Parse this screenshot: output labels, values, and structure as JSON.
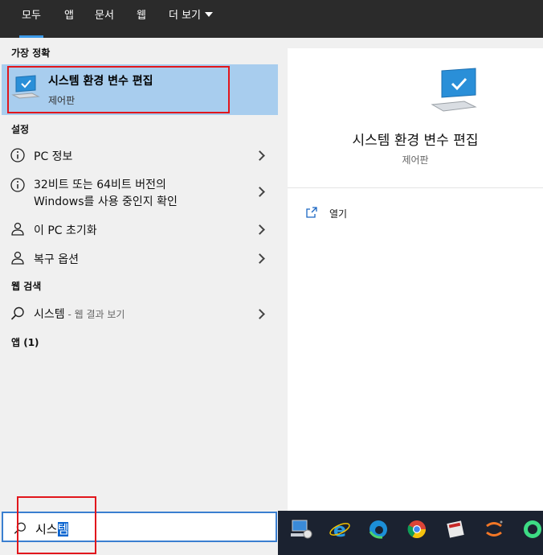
{
  "tabs": [
    {
      "label": "모두",
      "active": true
    },
    {
      "label": "앱"
    },
    {
      "label": "문서"
    },
    {
      "label": "웹"
    },
    {
      "label": "더 보기"
    }
  ],
  "best_match": {
    "heading": "가장 정확",
    "title": "시스템 환경 변수 편집",
    "subtitle": "제어판"
  },
  "settings": {
    "heading": "설정",
    "items": [
      {
        "label": "PC 정보",
        "icon": "info-icon"
      },
      {
        "label_line1": "32비트 또는 64비트 버전의",
        "label_line2": "Windows를 사용 중인지 확인",
        "icon": "info-icon"
      },
      {
        "label": "이 PC 초기화",
        "icon": "reset-icon"
      },
      {
        "label": "복구 옵션",
        "icon": "recovery-icon"
      }
    ]
  },
  "web_search": {
    "heading": "웹 검색",
    "query": "시스템",
    "suffix": " - 웹 결과 보기"
  },
  "apps": {
    "heading": "앱 (1)"
  },
  "detail": {
    "title": "시스템 환경 변수 편집",
    "subtitle": "제어판",
    "open_label": "열기"
  },
  "search": {
    "typed": "시스",
    "selected": "템"
  },
  "taskbar": {
    "icons": [
      "system-properties-icon",
      "internet-explorer-icon",
      "edge-icon",
      "chrome-icon",
      "app-icon",
      "jupyter-icon",
      "android-studio-icon"
    ]
  },
  "colors": {
    "accent": "#3c9ae8",
    "selection": "#a8cdee",
    "highlight_box": "#e1161c",
    "taskbar": "#1b2230"
  }
}
